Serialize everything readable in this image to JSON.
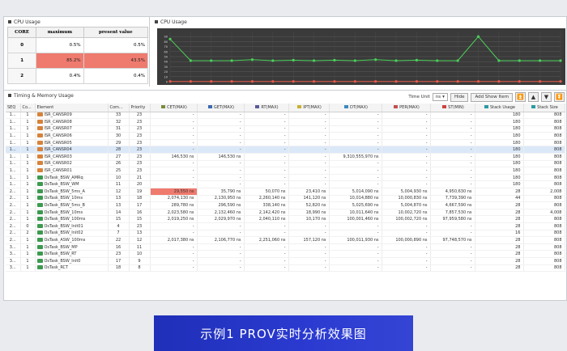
{
  "cpu_panel": {
    "title": "CPU Usage"
  },
  "cpu_table": {
    "headers": [
      "CORE",
      "maximum",
      "present value"
    ],
    "rows": [
      {
        "core": "0",
        "maximum": "0.5%",
        "present": "0.5%",
        "hot": false
      },
      {
        "core": "1",
        "maximum": "85.2%",
        "present": "43.5%",
        "hot": true
      },
      {
        "core": "2",
        "maximum": "0.4%",
        "present": "0.4%",
        "hot": false
      }
    ]
  },
  "cpu_chart": {
    "title": "CPU Usage",
    "grid": true
  },
  "chart_data": {
    "type": "line",
    "title": "CPU Usage",
    "ylim": [
      0,
      100
    ],
    "y_ticks": [
      0,
      10,
      20,
      30,
      40,
      50,
      60,
      70,
      80,
      90
    ],
    "series": [
      {
        "values": [
          85,
          42,
          42,
          42,
          44,
          42,
          43,
          42,
          43,
          42,
          44,
          42,
          43,
          42,
          42,
          90,
          42,
          42,
          42,
          42
        ],
        "color": "#4cd05a"
      },
      {
        "values": [
          0.5,
          0.5,
          0.5,
          0.5,
          0.5,
          0.5,
          0.5,
          0.5,
          0.5,
          0.5,
          0.5,
          0.5,
          0.5,
          0.5,
          0.5,
          0.5,
          0.5,
          0.5,
          0.5,
          0.5
        ],
        "color": "#e65a4a"
      }
    ]
  },
  "timing_panel": {
    "title": "Timing & Memory Usage",
    "time_unit_label": "Time Unit",
    "time_unit_value": "ns",
    "hide_label": "Hide",
    "add_show_label": "Add Show Item"
  },
  "columns": [
    {
      "label": "SEQ",
      "icon": ""
    },
    {
      "label": "Co...",
      "icon": ""
    },
    {
      "label": "Element",
      "icon": ""
    },
    {
      "label": "Com...",
      "icon": ""
    },
    {
      "label": "Priority",
      "icon": ""
    },
    {
      "label": "CET(MAX)",
      "icon": "#7a8a3a"
    },
    {
      "label": "GET(MAX)",
      "icon": "#3a6ab0"
    },
    {
      "label": "RT(MAX)",
      "icon": "#5a5a9a"
    },
    {
      "label": "IPT(MAX)",
      "icon": "#c8b030"
    },
    {
      "label": "DT(MAX)",
      "icon": "#3a8ac0"
    },
    {
      "label": "PER(MAX)",
      "icon": "#c05050"
    },
    {
      "label": "ST(MIN)",
      "icon": "#d04040"
    },
    {
      "label": "Stack Usage",
      "icon": "#2a9aa0"
    },
    {
      "label": "Stack Size",
      "icon": "#2a9aa0"
    }
  ],
  "rows": [
    [
      "1...",
      "1",
      "ISR_CANSR09",
      "33",
      "23",
      "-",
      "-",
      "-",
      "-",
      "-",
      "-",
      "-",
      "180",
      "808",
      "isr",
      false,
      false
    ],
    [
      "1...",
      "1",
      "ISR_CANSR08",
      "32",
      "23",
      "-",
      "-",
      "-",
      "-",
      "-",
      "-",
      "-",
      "180",
      "808",
      "isr",
      false,
      false
    ],
    [
      "1...",
      "1",
      "ISR_CANSR07",
      "31",
      "23",
      "-",
      "-",
      "-",
      "-",
      "-",
      "-",
      "-",
      "180",
      "808",
      "isr",
      false,
      false
    ],
    [
      "1...",
      "1",
      "ISR_CANSR06",
      "30",
      "23",
      "-",
      "-",
      "-",
      "-",
      "-",
      "-",
      "-",
      "180",
      "808",
      "isr",
      false,
      false
    ],
    [
      "1...",
      "1",
      "ISR_CANSR05",
      "29",
      "23",
      "-",
      "-",
      "-",
      "-",
      "-",
      "-",
      "-",
      "180",
      "808",
      "isr",
      false,
      false
    ],
    [
      "1...",
      "1",
      "ISR_CANSR04",
      "28",
      "23",
      "-",
      "-",
      "-",
      "-",
      "-",
      "-",
      "-",
      "180",
      "808",
      "isr",
      true,
      false
    ],
    [
      "1...",
      "1",
      "ISR_CANSR03",
      "27",
      "23",
      "146,530 ns",
      "146,530 ns",
      "-",
      "-",
      "9,310,555,970 ns",
      "-",
      "-",
      "180",
      "808",
      "isr",
      false,
      false
    ],
    [
      "1...",
      "1",
      "ISR_CANSR02",
      "26",
      "23",
      "-",
      "-",
      "-",
      "-",
      "-",
      "-",
      "-",
      "180",
      "808",
      "isr",
      false,
      false
    ],
    [
      "1...",
      "1",
      "ISR_CANSR01",
      "25",
      "23",
      "-",
      "-",
      "-",
      "-",
      "-",
      "-",
      "-",
      "180",
      "808",
      "isr",
      false,
      false
    ],
    [
      "1...",
      "1",
      "OsTask_BSW_AMRq",
      "10",
      "21",
      "-",
      "-",
      "-",
      "-",
      "-",
      "-",
      "-",
      "180",
      "808",
      "task",
      false,
      false
    ],
    [
      "1...",
      "1",
      "OsTask_BSW_WM",
      "11",
      "20",
      "-",
      "-",
      "-",
      "-",
      "-",
      "-",
      "-",
      "180",
      "808",
      "task",
      false,
      false
    ],
    [
      "2...",
      "1",
      "OsTask_BSW_5ms_A",
      "12",
      "19",
      "29,550 ns",
      "35,790 ns",
      "50,070 ns",
      "23,410 ns",
      "5,014,090 ns",
      "5,004,930 ns",
      "4,950,630 ns",
      "28",
      "2,008",
      "task",
      false,
      true
    ],
    [
      "2...",
      "1",
      "OsTask_BSW_10ms",
      "13",
      "18",
      "2,074,130 ns",
      "2,130,950 ns",
      "2,260,140 ns",
      "141,120 ns",
      "10,014,880 ns",
      "10,000,830 ns",
      "7,739,390 ns",
      "44",
      "808",
      "task",
      false,
      false
    ],
    [
      "2...",
      "1",
      "OsTask_BSW_5ms_B",
      "13",
      "17",
      "289,780 ns",
      "296,590 ns",
      "338,140 ns",
      "52,820 ns",
      "5,025,690 ns",
      "5,004,870 ns",
      "4,667,590 ns",
      "28",
      "808",
      "task",
      false,
      false
    ],
    [
      "2...",
      "1",
      "OsTask_BSW_10ms",
      "14",
      "16",
      "2,023,580 ns",
      "2,132,460 ns",
      "2,142,420 ns",
      "18,990 ns",
      "10,011,640 ns",
      "10,002,720 ns",
      "7,857,530 ns",
      "28",
      "4,008",
      "task",
      false,
      false
    ],
    [
      "2...",
      "1",
      "OsTask_BSW_100ms",
      "15",
      "15",
      "2,019,250 ns",
      "2,029,970 ns",
      "2,040,110 ns",
      "10,170 ns",
      "100,001,460 ns",
      "100,002,720 ns",
      "97,959,580 ns",
      "28",
      "808",
      "task",
      false,
      false
    ],
    [
      "2...",
      "0",
      "OsTask_BSW_Init01",
      "4",
      "23",
      "-",
      "-",
      "-",
      "-",
      "-",
      "-",
      "-",
      "28",
      "808",
      "task",
      false,
      false
    ],
    [
      "2...",
      "2",
      "OsTask_BSW_Init02",
      "7",
      "13",
      "-",
      "-",
      "-",
      "-",
      "-",
      "-",
      "-",
      "16",
      "808",
      "task",
      false,
      false
    ],
    [
      "2...",
      "1",
      "OsTask_ASW_100ms",
      "22",
      "12",
      "2,017,380 ns",
      "2,106,770 ns",
      "2,251,060 ns",
      "157,120 ns",
      "100,011,930 ns",
      "100,000,890 ns",
      "97,748,570 ns",
      "28",
      "808",
      "task",
      false,
      false
    ],
    [
      "3...",
      "1",
      "OsTask_BSW_MP",
      "16",
      "11",
      "-",
      "-",
      "-",
      "-",
      "-",
      "-",
      "-",
      "28",
      "808",
      "task",
      false,
      false
    ],
    [
      "3...",
      "1",
      "OsTask_BSW_RT",
      "23",
      "10",
      "-",
      "-",
      "-",
      "-",
      "-",
      "-",
      "-",
      "28",
      "808",
      "task",
      false,
      false
    ],
    [
      "3...",
      "1",
      "OsTask_BSW_Init0",
      "17",
      "9",
      "-",
      "-",
      "-",
      "-",
      "-",
      "-",
      "-",
      "28",
      "808",
      "task",
      false,
      false
    ],
    [
      "3...",
      "1",
      "OsTask_RCT",
      "18",
      "8",
      "-",
      "-",
      "-",
      "-",
      "-",
      "-",
      "-",
      "28",
      "808",
      "task",
      false,
      false
    ]
  ],
  "caption": "示例1  PROV实时分析效果图"
}
